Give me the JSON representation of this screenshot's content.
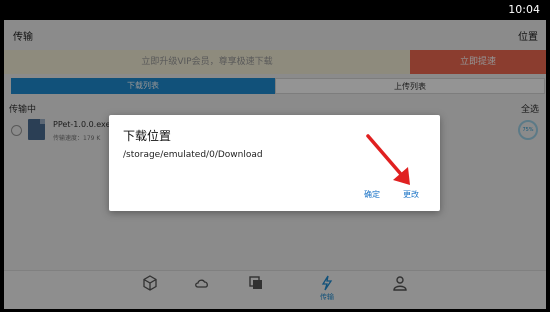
{
  "status_bar": {
    "time": "10:04"
  },
  "header": {
    "title": "传输",
    "location": "位置"
  },
  "vip_banner": {
    "text": "立即升级VIP会员，尊享极速下载",
    "button": "立即提速"
  },
  "tabs": {
    "download": "下载列表",
    "upload": "上传列表"
  },
  "section": {
    "title": "传输中",
    "select_all": "全选"
  },
  "task": {
    "name": "PPet-1.0.0.exe",
    "speed": "传输速度：179 K",
    "progress": "75%"
  },
  "dialog": {
    "title": "下载位置",
    "path": "/storage/emulated/0/Download",
    "confirm": "确定",
    "change": "更改"
  },
  "bottom_nav": {
    "items": [
      {
        "icon": "box-icon",
        "label": ""
      },
      {
        "icon": "cloud-icon",
        "label": ""
      },
      {
        "icon": "files-icon",
        "label": ""
      },
      {
        "icon": "transfer-icon",
        "label": "传输"
      },
      {
        "icon": "user-icon",
        "label": ""
      }
    ]
  },
  "colors": {
    "accent": "#1e8cd2",
    "vip_button": "#f06a52",
    "arrow": "#e02020"
  }
}
